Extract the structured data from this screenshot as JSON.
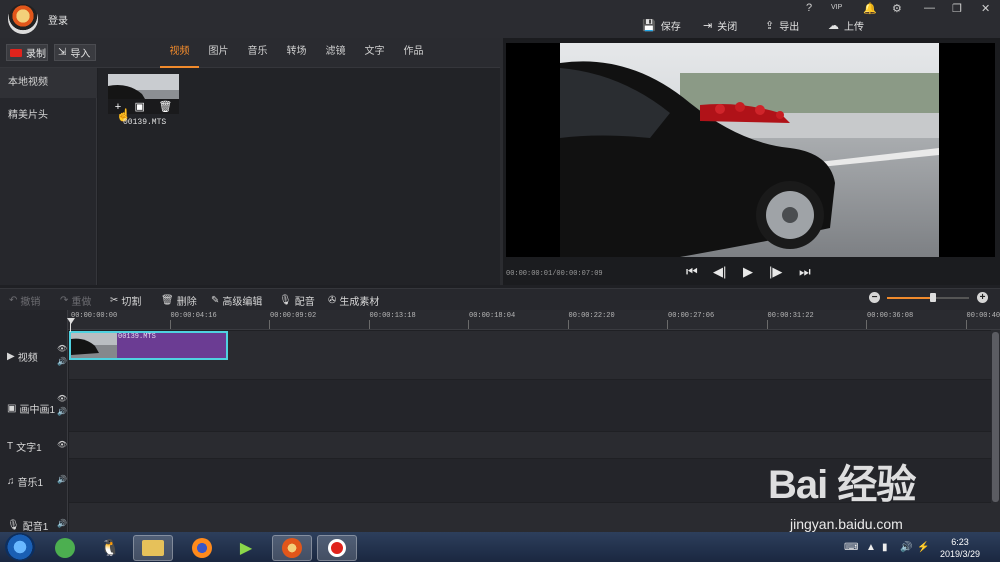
{
  "topbar": {
    "login": "登录",
    "help": "?",
    "vip": "VIP",
    "actions": [
      {
        "icon": "save-icon",
        "label": "保存"
      },
      {
        "icon": "close-project-icon",
        "label": "关闭"
      },
      {
        "icon": "export-icon",
        "label": "导出"
      },
      {
        "icon": "upload-icon",
        "label": "上传"
      }
    ]
  },
  "library": {
    "record_label": "录制",
    "import_label": "导入",
    "tabs": [
      "视频",
      "图片",
      "音乐",
      "转场",
      "滤镜",
      "文字",
      "作品"
    ],
    "active_tab": "视频",
    "nav": [
      "本地视频",
      "精美片头"
    ],
    "item": {
      "name": "00139.MTS"
    }
  },
  "preview": {
    "timecode": "00:00:00:01/00:00:07:09"
  },
  "toolbar": {
    "undo": "撤销",
    "redo": "重做",
    "cut": "切割",
    "delete": "删除",
    "advanced": "高级编辑",
    "dub": "配音",
    "generate": "生成素材",
    "zoom_level": 0.56
  },
  "timeline": {
    "ticks": [
      "00:00:00:00",
      "00:00:04:16",
      "00:00:09:02",
      "00:00:13:18",
      "00:00:18:04",
      "00:00:22:20",
      "00:00:27:06",
      "00:00:31:22",
      "00:00:36:08",
      "00:00:40:"
    ],
    "tracks": [
      {
        "label": "视频",
        "icon": "video-track-icon"
      },
      {
        "label": "画中画1",
        "icon": "pip-track-icon"
      },
      {
        "label": "文字1",
        "icon": "text-track-icon"
      },
      {
        "label": "音乐1",
        "icon": "music-track-icon"
      },
      {
        "label": "配音1",
        "icon": "mic-track-icon"
      }
    ],
    "clip_name": "00139.MTS"
  },
  "taskbar": {
    "time": "6:23",
    "date": "2019/3/29"
  },
  "watermark": {
    "brand": "Bai 经验",
    "url": "jingyan.baidu.com"
  },
  "colors": {
    "accent": "#f08a2c",
    "clip": "#6b3c93",
    "clip_border": "#4fd2e0",
    "record": "#e0231c"
  }
}
